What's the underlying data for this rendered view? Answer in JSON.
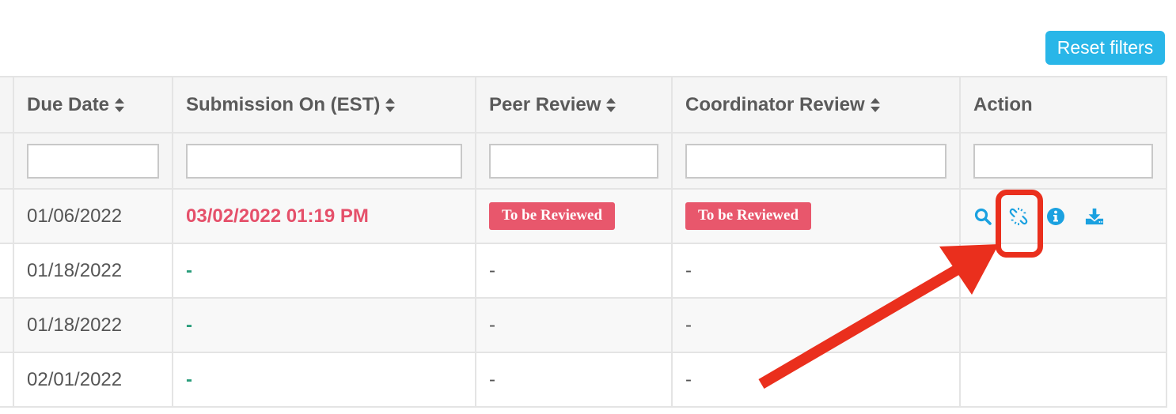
{
  "toolbar": {
    "reset_label": "Reset filters"
  },
  "table": {
    "columns": [
      {
        "label": "Due Date",
        "sortable": true
      },
      {
        "label": "Submission On (EST)",
        "sortable": true
      },
      {
        "label": "Peer Review",
        "sortable": true
      },
      {
        "label": "Coordinator Review",
        "sortable": true
      },
      {
        "label": "Action",
        "sortable": false
      }
    ],
    "rows": [
      {
        "due": "01/06/2022",
        "submission": "03/02/2022 01:19 PM",
        "peer": "To be Reviewed",
        "coordinator": "To be Reviewed",
        "actions": [
          "search-icon",
          "unlink-icon",
          "info-icon",
          "download-icon"
        ]
      },
      {
        "due": "01/18/2022",
        "submission": "-",
        "peer": "-",
        "coordinator": "-"
      },
      {
        "due": "01/18/2022",
        "submission": "-",
        "peer": "-",
        "coordinator": "-"
      },
      {
        "due": "02/01/2022",
        "submission": "-",
        "peer": "-",
        "coordinator": "-"
      }
    ]
  },
  "colors": {
    "accent": "#29b6e8",
    "overdue_text": "#e5506a",
    "badge_bg": "#e8576c",
    "dash_green": "#2a9d7b",
    "annotation_red": "#ea2f1d"
  }
}
